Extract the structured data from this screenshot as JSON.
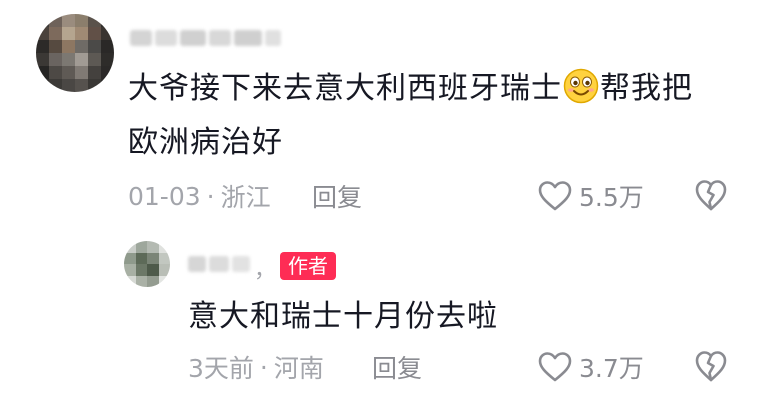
{
  "comments": [
    {
      "text_line1": "大爷接下来去意大利西班牙瑞士",
      "text_after_emoji": "帮我把",
      "text_line2": "欧洲病治好",
      "date": "01-03",
      "location": "浙江",
      "separator": "·",
      "reply_label": "回复",
      "likes": "5.5万",
      "emoji_icon": "smiling-face-emoji-icon",
      "like_icon": "heart-outline-icon",
      "dislike_icon": "broken-heart-icon"
    },
    {
      "author_badge": "作者",
      "comma": "，",
      "text": "意大和瑞士十月份去啦",
      "date": "3天前",
      "location": "河南",
      "separator": "·",
      "reply_label": "回复",
      "likes": "3.7万",
      "like_icon": "heart-outline-icon",
      "dislike_icon": "broken-heart-icon"
    }
  ],
  "colors": {
    "text": "#161823",
    "meta": "#a3a5ab",
    "action": "#8a8b91",
    "badge": "#fe2c55"
  }
}
